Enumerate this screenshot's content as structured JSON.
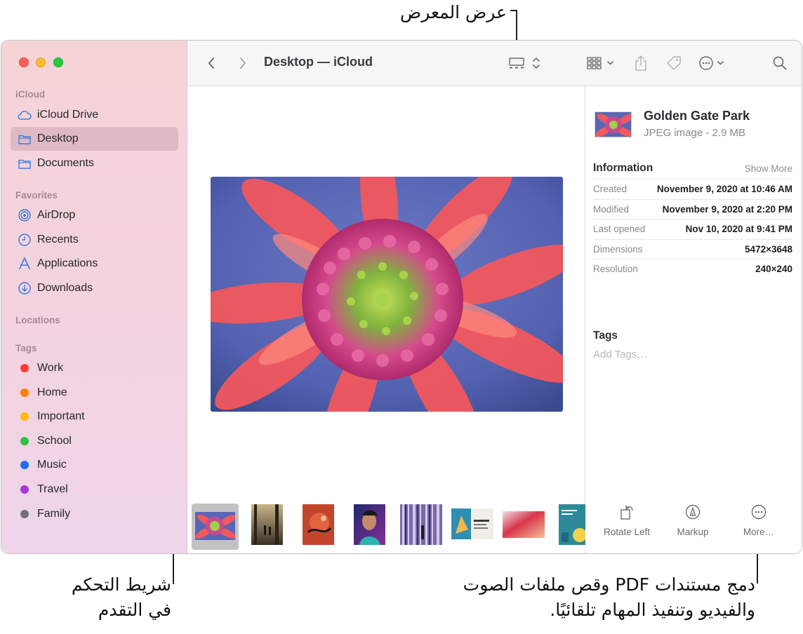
{
  "annotations": {
    "gallery_view": "عرض المعرض",
    "scrubber_line1": "شريط التحكم",
    "scrubber_line2": "في التقدم",
    "more_line1": "دمج مستندات PDF وقص ملفات الصوت",
    "more_line2": "والفيديو وتنفيذ المهام تلقائيًا."
  },
  "toolbar": {
    "back_icon": "chevron-left-icon",
    "forward_icon": "chevron-right-icon",
    "title": "Desktop — iCloud",
    "view_icon": "gallery-view-icon",
    "group_icon": "group-grid-icon",
    "share_icon": "share-icon",
    "tag_icon": "tag-icon",
    "action_icon": "ellipsis-circle-icon",
    "search_icon": "search-icon"
  },
  "sidebar": {
    "sections": {
      "icloud": "iCloud",
      "favorites": "Favorites",
      "locations": "Locations",
      "tags": "Tags"
    },
    "icloud_items": [
      {
        "label": "iCloud Drive",
        "icon": "cloud-icon"
      },
      {
        "label": "Desktop",
        "icon": "folder-icon",
        "selected": true
      },
      {
        "label": "Documents",
        "icon": "folder-icon"
      }
    ],
    "favorite_items": [
      {
        "label": "AirDrop",
        "icon": "airdrop-icon"
      },
      {
        "label": "Recents",
        "icon": "clock-icon"
      },
      {
        "label": "Applications",
        "icon": "applications-icon"
      },
      {
        "label": "Downloads",
        "icon": "download-icon"
      }
    ],
    "tags": [
      {
        "label": "Work",
        "color": "#fe3b30"
      },
      {
        "label": "Home",
        "color": "#fe8000"
      },
      {
        "label": "Important",
        "color": "#fdba00"
      },
      {
        "label": "School",
        "color": "#2fc143"
      },
      {
        "label": "Music",
        "color": "#1f6bf5"
      },
      {
        "label": "Travel",
        "color": "#a63ad6"
      },
      {
        "label": "Family",
        "color": "#74707a"
      }
    ]
  },
  "preview": {
    "name": "Golden Gate Park",
    "kind": "JPEG image - 2.9 MB",
    "information_label": "Information",
    "show_more": "Show More",
    "info": [
      {
        "key": "Created",
        "value": "November 9, 2020 at 10:46 AM"
      },
      {
        "key": "Modified",
        "value": "November 9, 2020 at 2:20 PM"
      },
      {
        "key": "Last opened",
        "value": "Nov 10, 2020 at 9:41 PM"
      },
      {
        "key": "Dimensions",
        "value": "5472×3648"
      },
      {
        "key": "Resolution",
        "value": "240×240"
      }
    ],
    "tags_label": "Tags",
    "add_tags": "Add Tags…",
    "actions": [
      {
        "label": "Rotate Left",
        "icon": "rotate-left-icon"
      },
      {
        "label": "Markup",
        "icon": "markup-icon"
      },
      {
        "label": "More…",
        "icon": "more-icon"
      }
    ]
  }
}
